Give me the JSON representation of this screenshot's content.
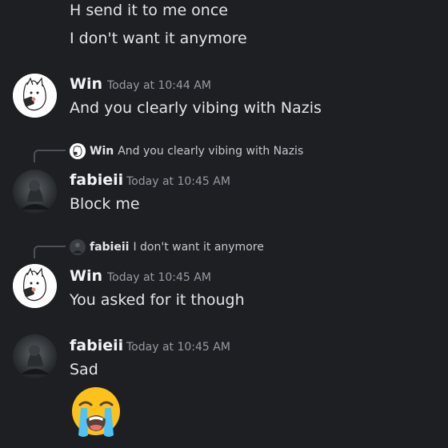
{
  "messages": {
    "top_line_1": "H send it to me once",
    "top_line_2": "I don't want it anymore",
    "msg1": {
      "author": "Win",
      "timestamp": "Today at 10:44 AM",
      "text": "And you clearly vibing with Nazis"
    },
    "msg2": {
      "reply_author": "Win",
      "reply_text": "And you clearly vibing with Nazis",
      "author": "fabieii",
      "timestamp": "Today at 10:45 AM",
      "text": "Block me"
    },
    "msg3": {
      "reply_author": "fabieii",
      "reply_text": "I don't want it anymore",
      "author": "Win",
      "timestamp": "Today at 10:45 AM",
      "text": "You asked for it though"
    },
    "msg4": {
      "author": "fabieii",
      "timestamp": "Today at 10:45 AM",
      "text": "Sad",
      "emoji": "loudly-crying-face"
    }
  },
  "colors": {
    "background": "#1e1f22",
    "text": "#e3e5e8",
    "timestamp": "#949ba4",
    "reply_spine": "#4e5058"
  }
}
